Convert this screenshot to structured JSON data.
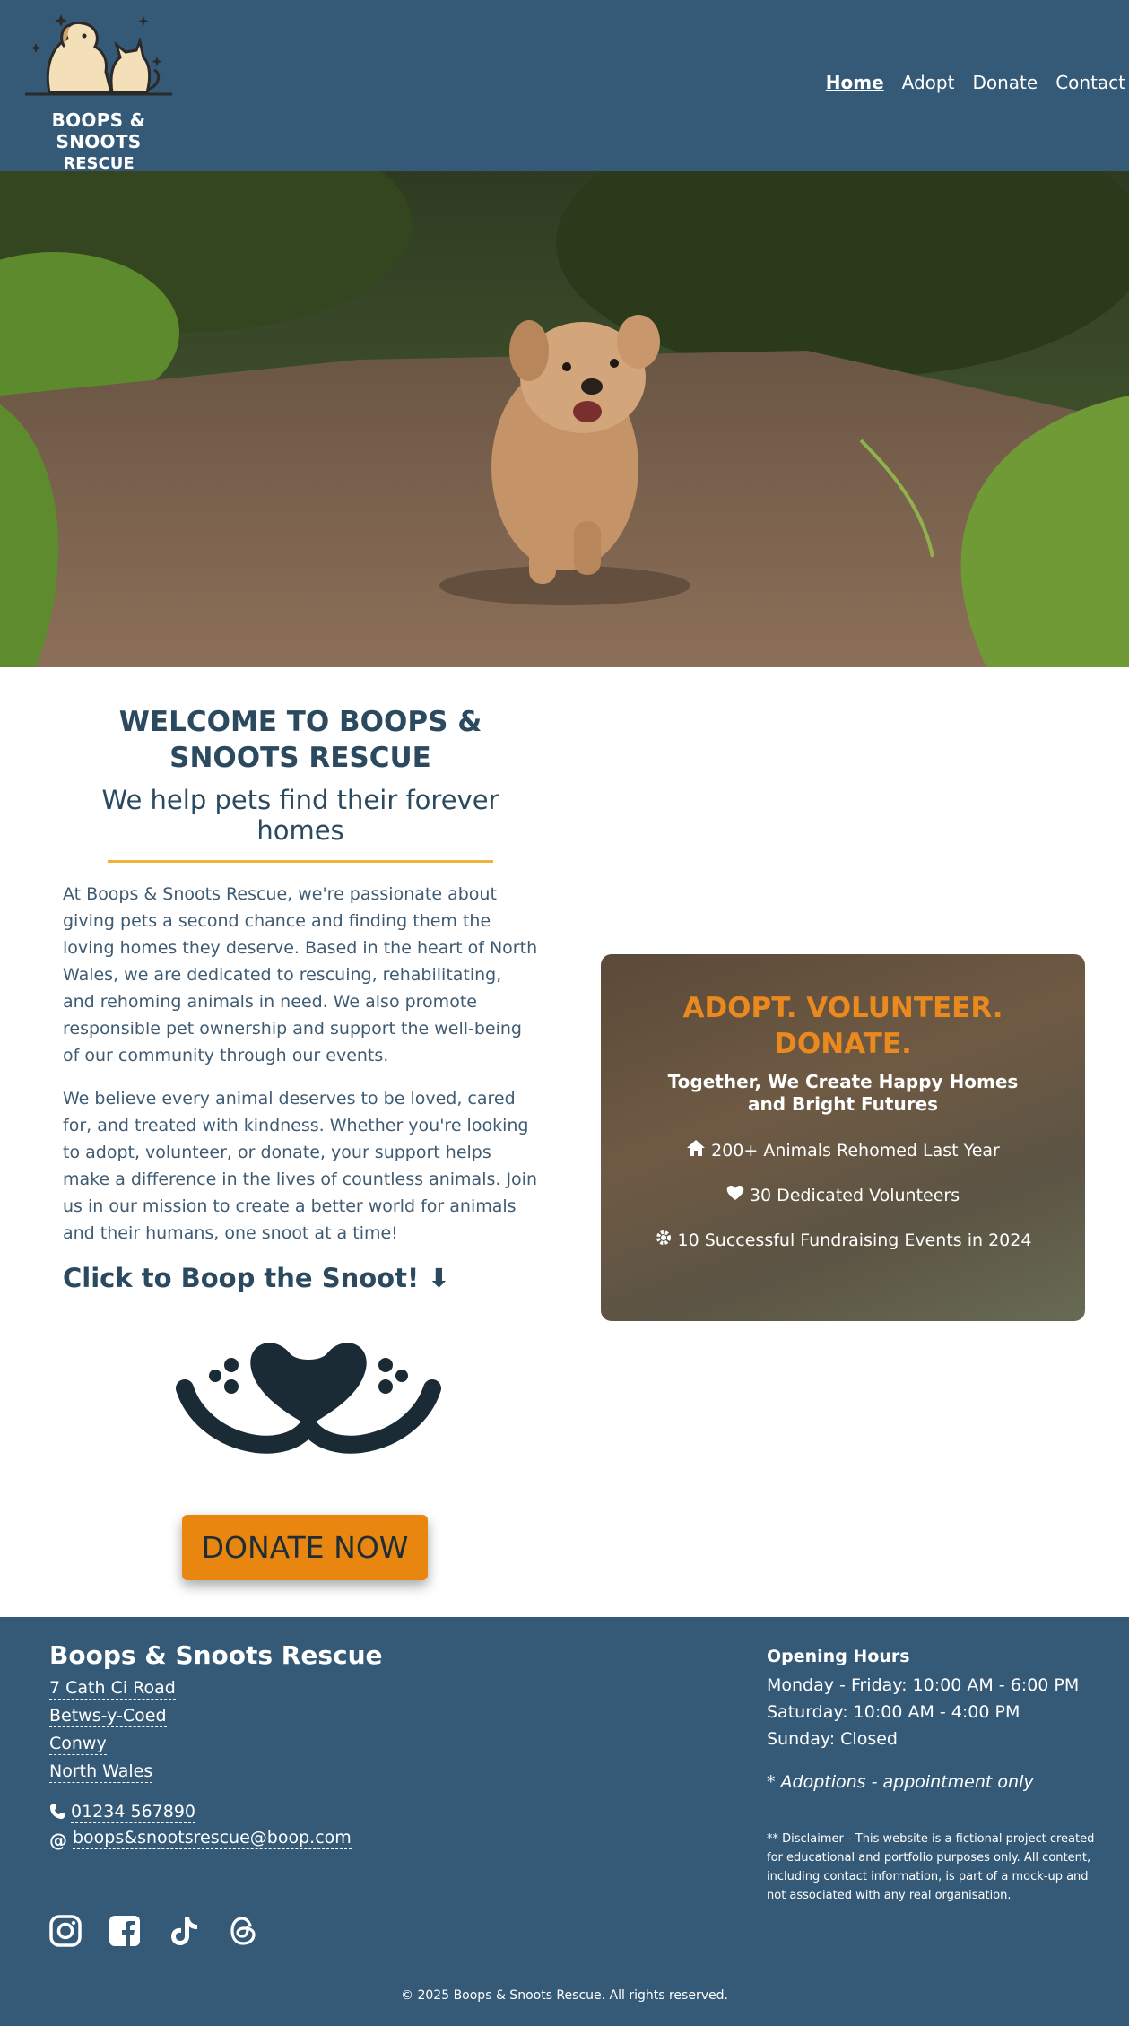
{
  "header": {
    "logo_line1": "BOOPS & SNOOTS",
    "logo_line2": "RESCUE",
    "nav": [
      {
        "label": "Home",
        "active": true
      },
      {
        "label": "Adopt",
        "active": false
      },
      {
        "label": "Donate",
        "active": false
      },
      {
        "label": "Contact",
        "active": false
      }
    ]
  },
  "hero": {
    "icon": "dog-running-photo"
  },
  "welcome": {
    "title": "WELCOME TO BOOPS & SNOOTS RESCUE",
    "subtitle": "We help pets find their forever homes",
    "paragraph1": "At Boops & Snoots Rescue, we're passionate about giving pets a second chance and finding them the loving homes they deserve. Based in the heart of North Wales, we are dedicated to rescuing, rehabilitating, and rehoming animals in need. We also promote responsible pet ownership and support the well-being of our community through our events.",
    "paragraph2": "We believe every animal deserves to be loved, cared for, and treated with kindness. Whether you're looking to adopt, volunteer, or donate, your support helps make a difference in the lives of countless animals. Join us in our mission to create a better world for animals and their humans, one snoot at a time!",
    "boop_label": "Click to Boop the Snoot! ⬇",
    "donate_label": "DONATE NOW"
  },
  "card": {
    "title": "ADOPT. VOLUNTEER. DONATE.",
    "subtitle": "Together, We Create Happy Homes and Bright Futures",
    "stats": [
      {
        "icon": "home-icon",
        "text": "200+ Animals Rehomed Last Year"
      },
      {
        "icon": "heart-icon",
        "text": "30 Dedicated Volunteers"
      },
      {
        "icon": "gear-icon",
        "text": "10 Successful Fundraising Events in 2024"
      }
    ]
  },
  "footer": {
    "name": "Boops & Snoots Rescue",
    "address": [
      "7 Cath Ci Road",
      "Betws-y-Coed",
      "Conwy",
      "North Wales"
    ],
    "phone": "01234 567890",
    "email": "boops&snootsrescue@boop.com",
    "hours_title": "Opening Hours",
    "hours": [
      "Monday - Friday: 10:00 AM - 6:00 PM",
      "Saturday: 10:00 AM - 4:00 PM",
      "Sunday: Closed"
    ],
    "note": "* Adoptions - appointment only",
    "disclaimer": "** Disclaimer - This website is a fictional project created for educational and portfolio purposes only. All content, including contact information, is part of a mock-up and not associated with any real organisation.",
    "copyright": "© 2025 Boops & Snoots Rescue. All rights reserved.",
    "social": [
      "instagram-icon",
      "facebook-icon",
      "tiktok-icon",
      "threads-icon"
    ]
  },
  "colors": {
    "header_bg": "#345a78",
    "accent_orange": "#e8860f",
    "divider_gold": "#f0b23a",
    "title_navy": "#2b4a5f"
  }
}
